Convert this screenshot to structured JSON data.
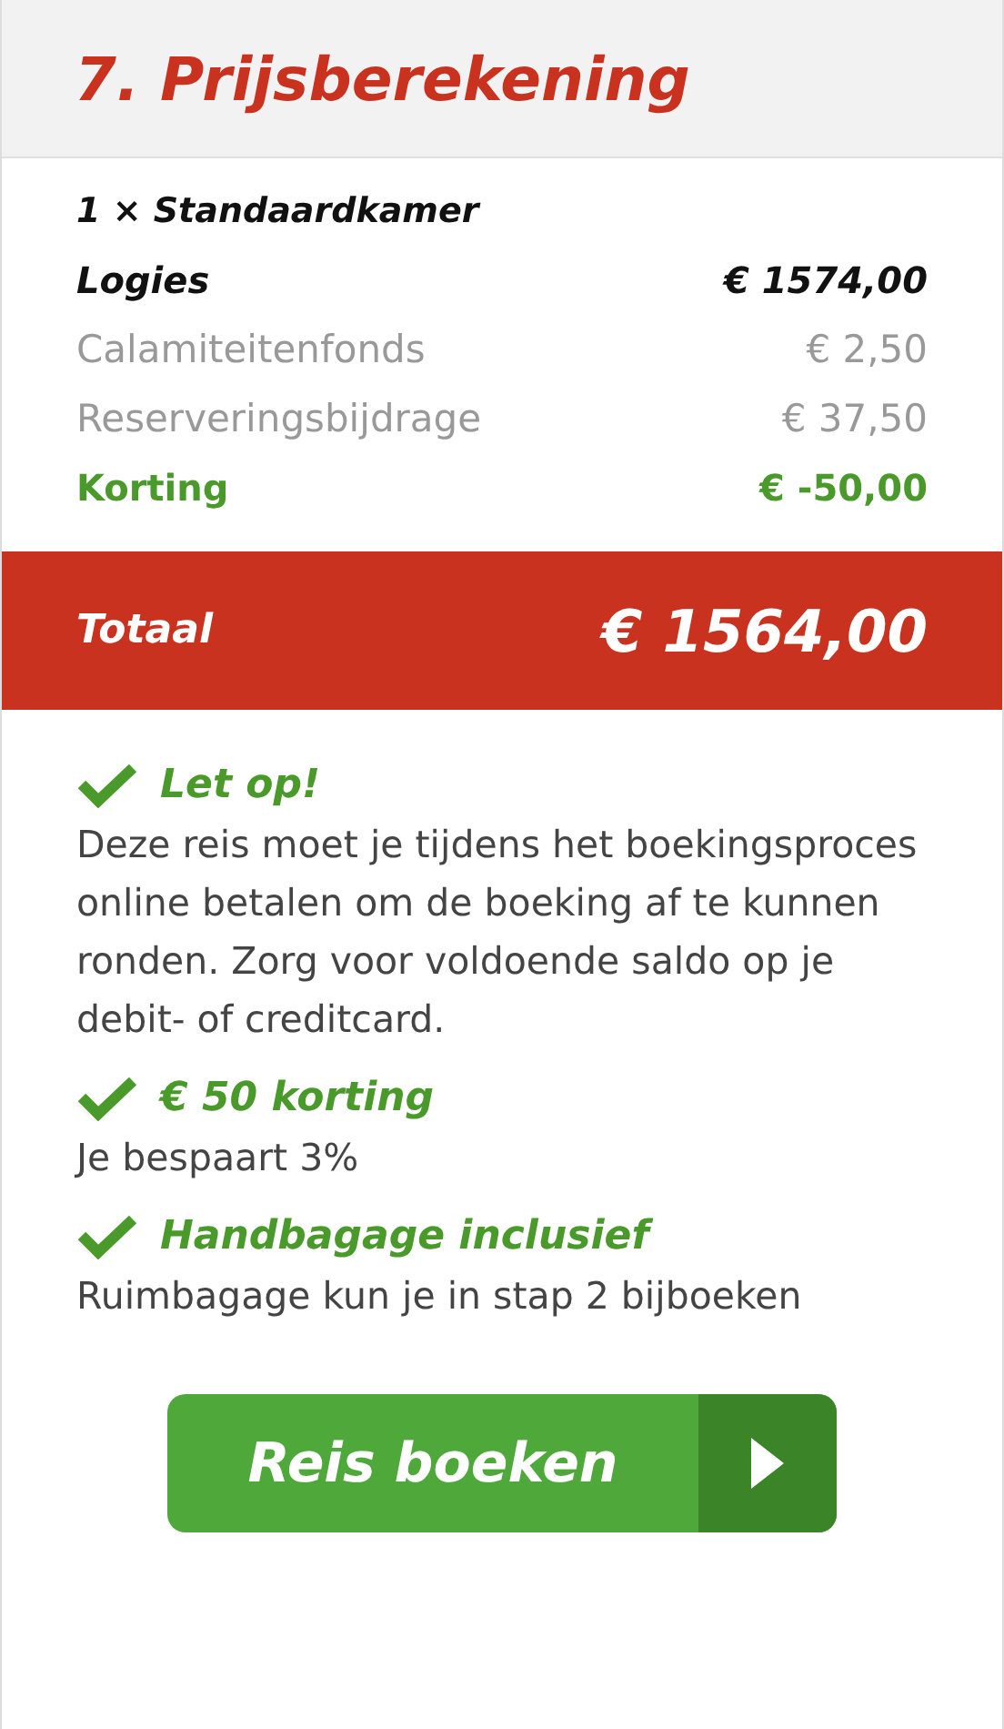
{
  "title": "7. Prijsberekening",
  "heading": "1 × Standaardkamer",
  "lines": [
    {
      "kind": "main",
      "label": "Logies",
      "amount": "€ 1574,00"
    },
    {
      "kind": "fee",
      "label": "Calamiteitenfonds",
      "amount": "€ 2,50"
    },
    {
      "kind": "fee",
      "label": "Reserveringsbijdrage",
      "amount": "€ 37,50"
    },
    {
      "kind": "discount",
      "label": "Korting",
      "amount": "€ -50,00"
    }
  ],
  "total": {
    "label": "Totaal",
    "amount": "€ 1564,00"
  },
  "notes": [
    {
      "title": "Let op!",
      "text": "Deze reis moet je tijdens het boekingsproces online betalen om de boeking af te kunnen ronden. Zorg voor voldoende saldo op je debit- of creditcard."
    },
    {
      "title": "€ 50 korting",
      "text": "Je bespaart 3%"
    },
    {
      "title": "Handbagage inclusief",
      "text": "Ruimbagage kun je in stap 2 bijboeken"
    }
  ],
  "button": {
    "label": "Reis boeken"
  }
}
